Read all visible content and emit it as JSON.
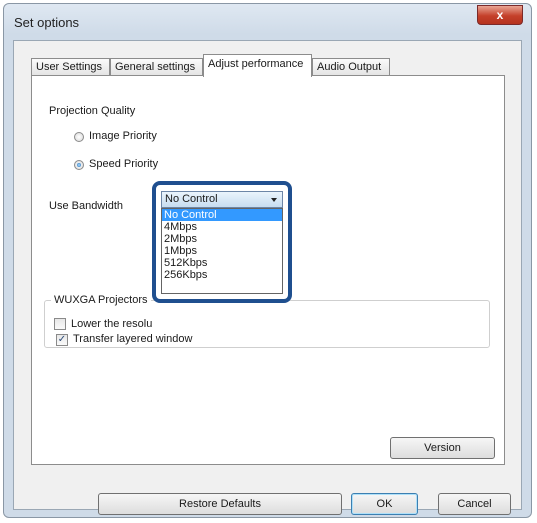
{
  "window": {
    "title": "Set options",
    "close_glyph": "x"
  },
  "tabs": [
    {
      "label": "User Settings"
    },
    {
      "label": "General settings"
    },
    {
      "label": "Adjust performance"
    },
    {
      "label": "Audio Output"
    }
  ],
  "active_tab": "Adjust performance",
  "projection_quality": {
    "label": "Projection Quality",
    "options": [
      {
        "label": "Image Priority",
        "selected": false
      },
      {
        "label": "Speed Priority",
        "selected": true
      }
    ]
  },
  "bandwidth": {
    "label": "Use Bandwidth",
    "selected": "No Control",
    "options": [
      "No Control",
      "4Mbps",
      "2Mbps",
      "1Mbps",
      "512Kbps",
      "256Kbps"
    ]
  },
  "wuxga_group": {
    "title": "WUXGA Projectors",
    "checkbox_label": "Lower the resolu",
    "checked": false
  },
  "layered_window": {
    "label": "Transfer layered window",
    "checked": true,
    "check_glyph": "✓"
  },
  "buttons": {
    "version": "Version",
    "restore_defaults": "Restore Defaults",
    "ok": "OK",
    "cancel": "Cancel"
  },
  "colors": {
    "highlight": "#3399ff",
    "callout_border": "#1f4f8f",
    "close_button": "#c4402a"
  }
}
